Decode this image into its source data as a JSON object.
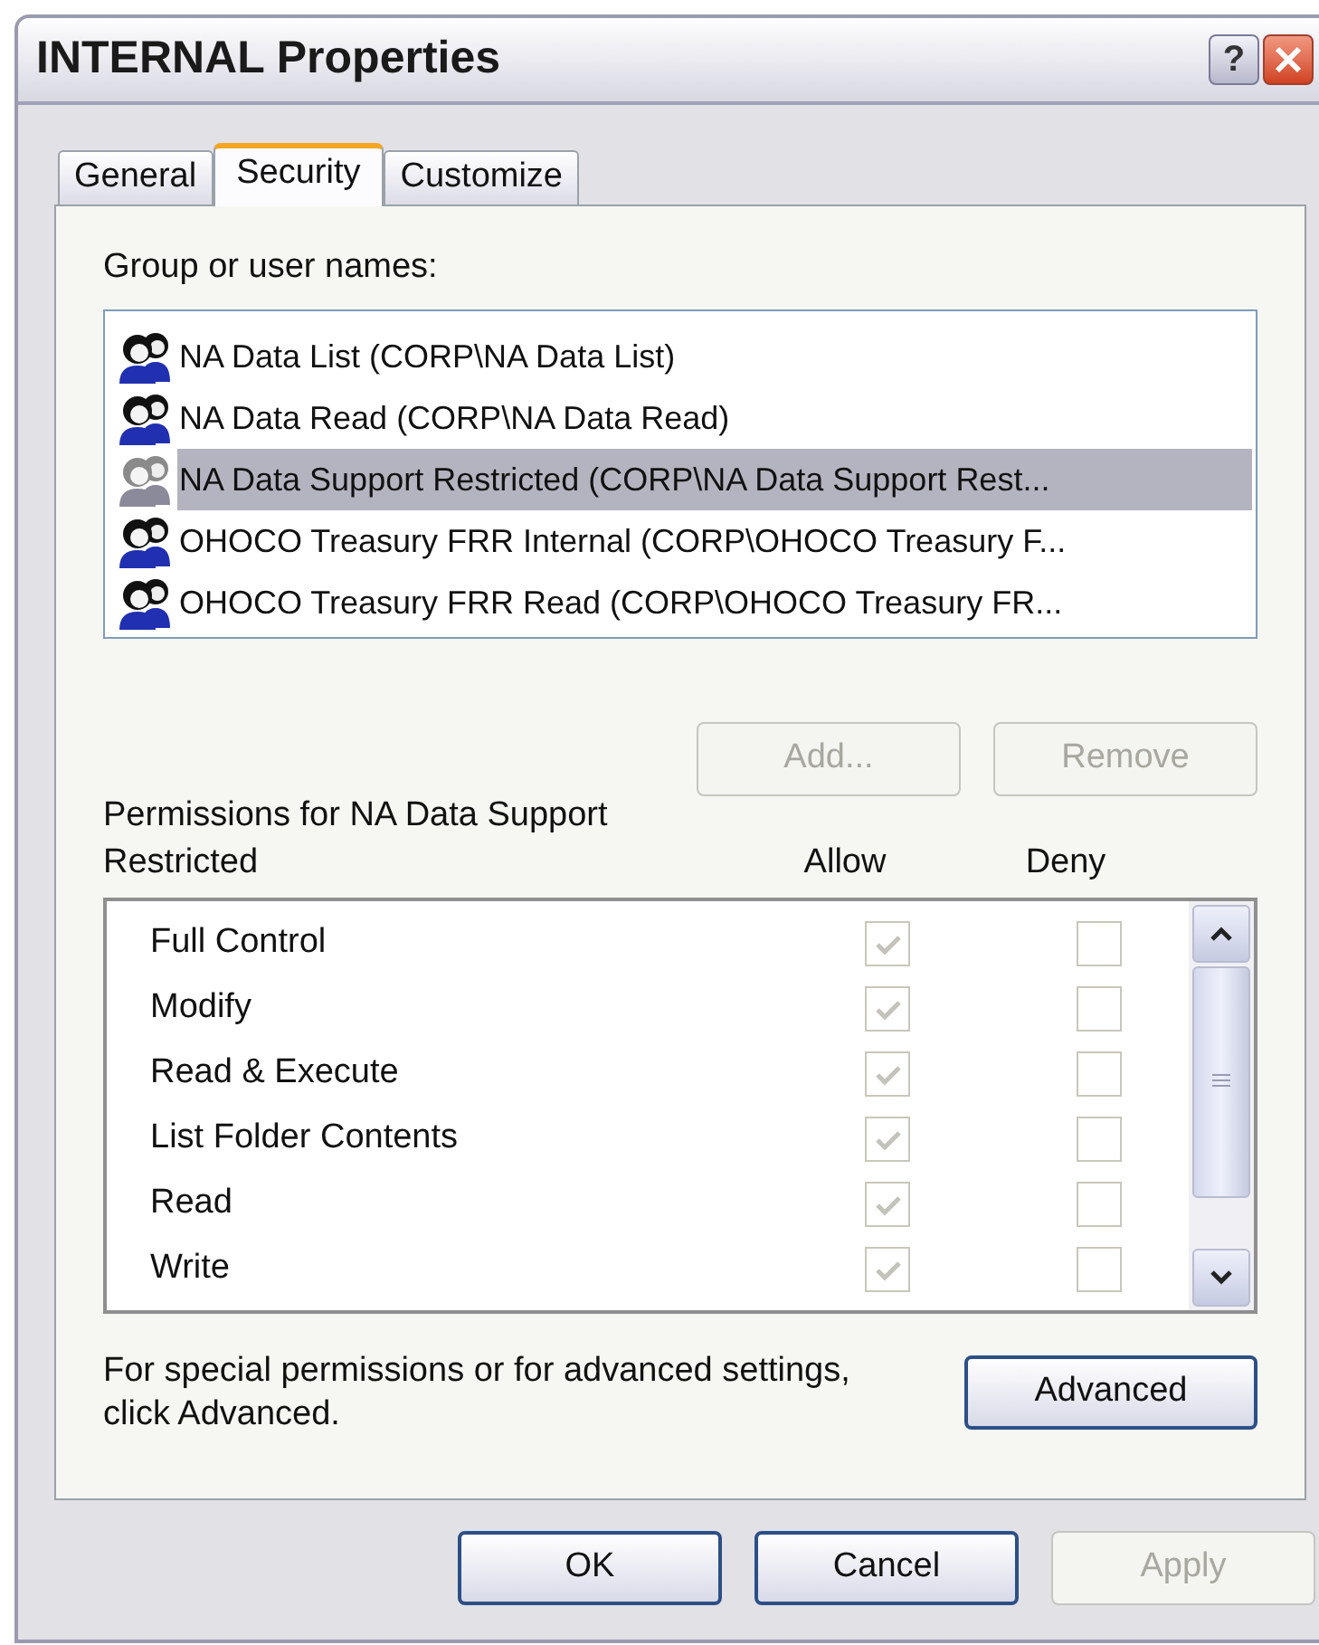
{
  "window": {
    "title": "INTERNAL Properties",
    "help_button": "?"
  },
  "tabs": [
    {
      "label": "General",
      "selected": false
    },
    {
      "label": "Security",
      "selected": true
    },
    {
      "label": "Customize",
      "selected": false
    }
  ],
  "group_label": "Group or user names:",
  "users": [
    {
      "name": "NA Data List (CORP\\NA Data List)",
      "selected": false
    },
    {
      "name": "NA Data Read (CORP\\NA Data Read)",
      "selected": false
    },
    {
      "name": "NA Data Support Restricted (CORP\\NA Data Support Rest...",
      "selected": true
    },
    {
      "name": "OHOCO Treasury FRR Internal (CORP\\OHOCO Treasury F...",
      "selected": false
    },
    {
      "name": "OHOCO Treasury FRR Read (CORP\\OHOCO Treasury FR...",
      "selected": false
    }
  ],
  "user_buttons": [
    {
      "label": "Add...",
      "disabled": true
    },
    {
      "label": "Remove",
      "disabled": true
    }
  ],
  "permissions_label": "Permissions for NA Data Support Restricted",
  "columns": [
    "Allow",
    "Deny"
  ],
  "permissions": [
    {
      "name": "Full Control",
      "allow": true,
      "deny": false
    },
    {
      "name": "Modify",
      "allow": true,
      "deny": false
    },
    {
      "name": "Read & Execute",
      "allow": true,
      "deny": false
    },
    {
      "name": "List Folder Contents",
      "allow": true,
      "deny": false
    },
    {
      "name": "Read",
      "allow": true,
      "deny": false
    },
    {
      "name": "Write",
      "allow": true,
      "deny": false
    }
  ],
  "advanced_text": "For special permissions or for advanced settings, click Advanced.",
  "advanced_button": "Advanced",
  "buttons": [
    {
      "label": "OK",
      "disabled": false
    },
    {
      "label": "Cancel",
      "disabled": false
    },
    {
      "label": "Apply",
      "disabled": true
    }
  ]
}
